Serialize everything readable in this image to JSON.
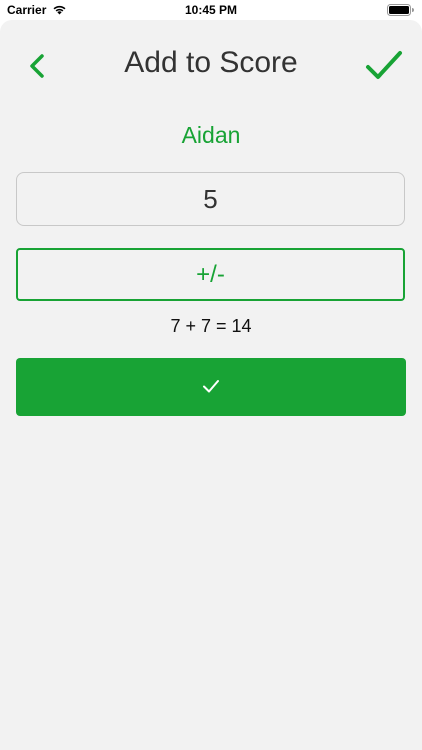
{
  "status_bar": {
    "carrier": "Carrier",
    "time": "10:45 PM",
    "wifi_icon": "wifi-icon",
    "battery_icon": "battery-icon"
  },
  "nav": {
    "title": "Add to Score",
    "back_icon": "chevron-left-icon",
    "done_icon": "checkmark-icon"
  },
  "player": {
    "name": "Aidan"
  },
  "score_input": {
    "value": "5"
  },
  "sign_toggle": {
    "label": "+/-"
  },
  "equation": {
    "text": "7 + 7 = 14"
  },
  "submit": {
    "icon": "checkmark-icon"
  },
  "colors": {
    "accent": "#18a335",
    "sheet_background": "#f2f2f2",
    "title_text": "#333333"
  }
}
